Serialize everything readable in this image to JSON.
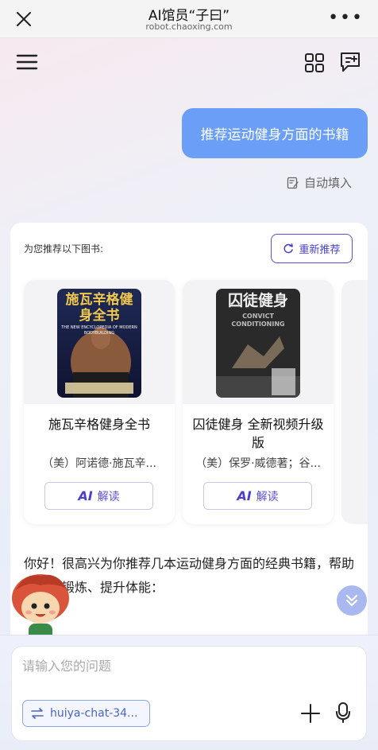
{
  "header": {
    "title": "AI馆员“子曰”",
    "subtitle": "robot.chaoxing.com"
  },
  "conversation": {
    "user_message": "推荐运动健身方面的书籍",
    "autofill_label": "自动填入",
    "recommend_label": "为您推荐以下图书:",
    "refresh_label": "重新推荐",
    "books": [
      {
        "title": "施瓦辛格健身全书",
        "author": "（美）阿诺德·施瓦辛...",
        "read_label": "解读",
        "cover_text": "施瓦辛格健身全书",
        "cover_subtitle": "THE NEW ENCYCLOPEDIA OF MODERN BODYBUILDING"
      },
      {
        "title": "囚徒健身 全新视频升级版",
        "author": "（美）保罗·威德著；谷...",
        "read_label": "解读",
        "cover_text": "囚徒健身",
        "cover_subtitle": "CONVICT CONDITIONING"
      }
    ],
    "ai_mark": "AI",
    "answer_text": "你好！很高兴为你推荐几本运动健身方面的经典书籍，帮助你科学锻炼、提升体能："
  },
  "input": {
    "placeholder": "请输入您的问题",
    "model_chip": "huiya-chat-34..."
  },
  "colors": {
    "accent": "#5a4fd6",
    "user_bubble": "#6b9ef6"
  }
}
